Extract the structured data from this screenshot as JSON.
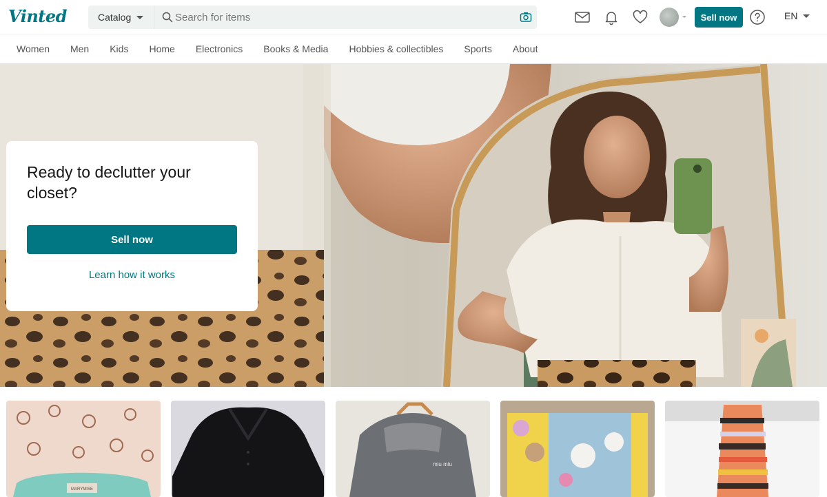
{
  "brand": {
    "logo_text": "Vinted",
    "accent": "#007782"
  },
  "search": {
    "catalog_label": "Catalog",
    "placeholder": "Search for items",
    "value": ""
  },
  "header": {
    "sell_label": "Sell now",
    "language": "EN",
    "icons": [
      "search-icon",
      "camera-icon",
      "inbox-icon",
      "bell-icon",
      "heart-icon",
      "help-icon"
    ]
  },
  "categories": [
    "Women",
    "Men",
    "Kids",
    "Home",
    "Electronics",
    "Books & Media",
    "Hobbies & collectibles",
    "Sports",
    "About"
  ],
  "hero": {
    "title": "Ready to declutter your closet?",
    "sell_label": "Sell now",
    "learn_label": "Learn how it works"
  },
  "item_previews": [
    {
      "label": "MARYMISE"
    },
    {
      "label": ""
    },
    {
      "label": "miu miu"
    },
    {
      "label": ""
    },
    {
      "label": ""
    }
  ]
}
